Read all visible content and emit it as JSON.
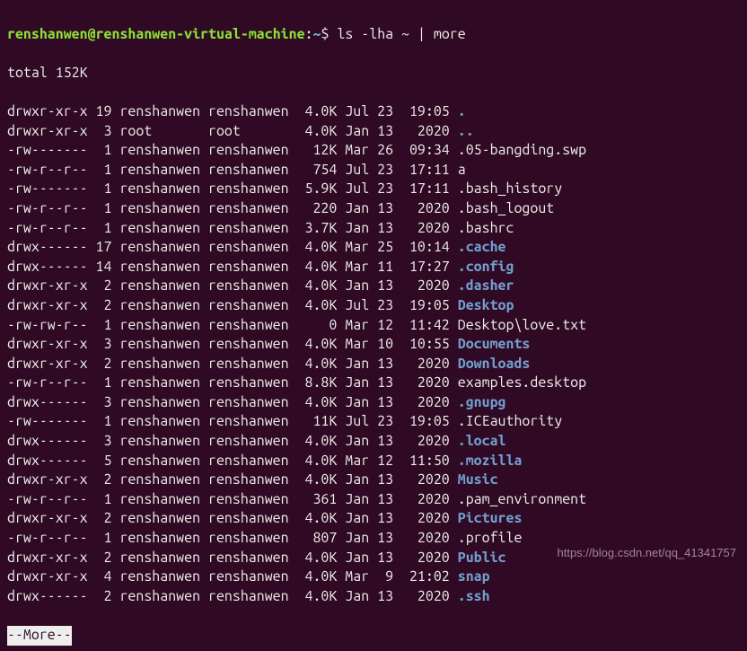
{
  "prompt": {
    "user": "renshanwen",
    "at": "@",
    "host": "renshanwen-virtual-machine",
    "colon": ":",
    "path": "~",
    "dollar": "$ ",
    "command": "ls -lha ~ | more"
  },
  "total_line": "total 152K",
  "more_prompt": "--More--",
  "watermark": "https://blog.csdn.net/qq_41341757",
  "files": [
    {
      "perm": "drwxr-xr-x",
      "links": "19",
      "owner": "renshanwen",
      "group": "renshanwen",
      "size": "4.0K",
      "date": "Jul 23",
      "time": "19:05",
      "name": ".",
      "dir": true
    },
    {
      "perm": "drwxr-xr-x",
      "links": "3",
      "owner": "root",
      "group": "root",
      "size": "4.0K",
      "date": "Jan 13",
      "time": " 2020",
      "name": "..",
      "dir": true
    },
    {
      "perm": "-rw-------",
      "links": "1",
      "owner": "renshanwen",
      "group": "renshanwen",
      "size": "12K",
      "date": "Mar 26",
      "time": "09:34",
      "name": ".05-bangding.swp",
      "dir": false
    },
    {
      "perm": "-rw-r--r--",
      "links": "1",
      "owner": "renshanwen",
      "group": "renshanwen",
      "size": "754",
      "date": "Jul 23",
      "time": "17:11",
      "name": "a",
      "dir": false
    },
    {
      "perm": "-rw-------",
      "links": "1",
      "owner": "renshanwen",
      "group": "renshanwen",
      "size": "5.9K",
      "date": "Jul 23",
      "time": "17:11",
      "name": ".bash_history",
      "dir": false
    },
    {
      "perm": "-rw-r--r--",
      "links": "1",
      "owner": "renshanwen",
      "group": "renshanwen",
      "size": "220",
      "date": "Jan 13",
      "time": " 2020",
      "name": ".bash_logout",
      "dir": false
    },
    {
      "perm": "-rw-r--r--",
      "links": "1",
      "owner": "renshanwen",
      "group": "renshanwen",
      "size": "3.7K",
      "date": "Jan 13",
      "time": " 2020",
      "name": ".bashrc",
      "dir": false
    },
    {
      "perm": "drwx------",
      "links": "17",
      "owner": "renshanwen",
      "group": "renshanwen",
      "size": "4.0K",
      "date": "Mar 25",
      "time": "10:14",
      "name": ".cache",
      "dir": true
    },
    {
      "perm": "drwx------",
      "links": "14",
      "owner": "renshanwen",
      "group": "renshanwen",
      "size": "4.0K",
      "date": "Mar 11",
      "time": "17:27",
      "name": ".config",
      "dir": true
    },
    {
      "perm": "drwxr-xr-x",
      "links": "2",
      "owner": "renshanwen",
      "group": "renshanwen",
      "size": "4.0K",
      "date": "Jan 13",
      "time": " 2020",
      "name": ".dasher",
      "dir": true
    },
    {
      "perm": "drwxr-xr-x",
      "links": "2",
      "owner": "renshanwen",
      "group": "renshanwen",
      "size": "4.0K",
      "date": "Jul 23",
      "time": "19:05",
      "name": "Desktop",
      "dir": true
    },
    {
      "perm": "-rw-rw-r--",
      "links": "1",
      "owner": "renshanwen",
      "group": "renshanwen",
      "size": "0",
      "date": "Mar 12",
      "time": "11:42",
      "name": "Desktop\\love.txt",
      "dir": false
    },
    {
      "perm": "drwxr-xr-x",
      "links": "3",
      "owner": "renshanwen",
      "group": "renshanwen",
      "size": "4.0K",
      "date": "Mar 10",
      "time": "10:55",
      "name": "Documents",
      "dir": true
    },
    {
      "perm": "drwxr-xr-x",
      "links": "2",
      "owner": "renshanwen",
      "group": "renshanwen",
      "size": "4.0K",
      "date": "Jan 13",
      "time": " 2020",
      "name": "Downloads",
      "dir": true
    },
    {
      "perm": "-rw-r--r--",
      "links": "1",
      "owner": "renshanwen",
      "group": "renshanwen",
      "size": "8.8K",
      "date": "Jan 13",
      "time": " 2020",
      "name": "examples.desktop",
      "dir": false
    },
    {
      "perm": "drwx------",
      "links": "3",
      "owner": "renshanwen",
      "group": "renshanwen",
      "size": "4.0K",
      "date": "Jan 13",
      "time": " 2020",
      "name": ".gnupg",
      "dir": true
    },
    {
      "perm": "-rw-------",
      "links": "1",
      "owner": "renshanwen",
      "group": "renshanwen",
      "size": "11K",
      "date": "Jul 23",
      "time": "19:05",
      "name": ".ICEauthority",
      "dir": false
    },
    {
      "perm": "drwx------",
      "links": "3",
      "owner": "renshanwen",
      "group": "renshanwen",
      "size": "4.0K",
      "date": "Jan 13",
      "time": " 2020",
      "name": ".local",
      "dir": true
    },
    {
      "perm": "drwx------",
      "links": "5",
      "owner": "renshanwen",
      "group": "renshanwen",
      "size": "4.0K",
      "date": "Mar 12",
      "time": "11:50",
      "name": ".mozilla",
      "dir": true
    },
    {
      "perm": "drwxr-xr-x",
      "links": "2",
      "owner": "renshanwen",
      "group": "renshanwen",
      "size": "4.0K",
      "date": "Jan 13",
      "time": " 2020",
      "name": "Music",
      "dir": true
    },
    {
      "perm": "-rw-r--r--",
      "links": "1",
      "owner": "renshanwen",
      "group": "renshanwen",
      "size": "361",
      "date": "Jan 13",
      "time": " 2020",
      "name": ".pam_environment",
      "dir": false
    },
    {
      "perm": "drwxr-xr-x",
      "links": "2",
      "owner": "renshanwen",
      "group": "renshanwen",
      "size": "4.0K",
      "date": "Jan 13",
      "time": " 2020",
      "name": "Pictures",
      "dir": true
    },
    {
      "perm": "-rw-r--r--",
      "links": "1",
      "owner": "renshanwen",
      "group": "renshanwen",
      "size": "807",
      "date": "Jan 13",
      "time": " 2020",
      "name": ".profile",
      "dir": false
    },
    {
      "perm": "drwxr-xr-x",
      "links": "2",
      "owner": "renshanwen",
      "group": "renshanwen",
      "size": "4.0K",
      "date": "Jan 13",
      "time": " 2020",
      "name": "Public",
      "dir": true
    },
    {
      "perm": "drwxr-xr-x",
      "links": "4",
      "owner": "renshanwen",
      "group": "renshanwen",
      "size": "4.0K",
      "date": "Mar  9",
      "time": "21:02",
      "name": "snap",
      "dir": true
    },
    {
      "perm": "drwx------",
      "links": "2",
      "owner": "renshanwen",
      "group": "renshanwen",
      "size": "4.0K",
      "date": "Jan 13",
      "time": " 2020",
      "name": ".ssh",
      "dir": true
    }
  ]
}
